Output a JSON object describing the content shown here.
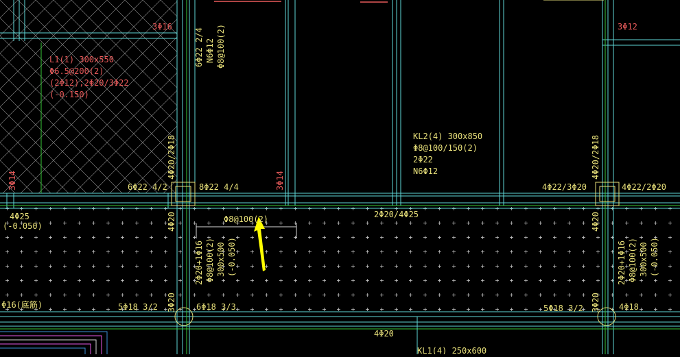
{
  "colors": {
    "background": "#000000",
    "beam_line": "#5fd7d7",
    "axis_line": "#37c837",
    "annotation_yellow": "#e8e07a",
    "annotation_red": "#e85a5a",
    "arrow": "#ffff00",
    "white": "#d8d8d8"
  },
  "annotations": {
    "l1_line1": "L1(1) 300x550",
    "l1_line2": "Φ6.5@200(2)",
    "l1_line3": "(2Φ12);2Φ20/3Φ22",
    "l1_line4": "(-0.150)",
    "kl2_line1": "KL2(4) 300x850",
    "kl2_line2": "Φ8@100/150(2)",
    "kl2_line3": "2Φ22",
    "kl2_line4": "N6Φ12",
    "top_left_3phi16": "3Φ16",
    "top_right_3phi12": "3Φ12",
    "col_left_v1": "6Φ22 2/4",
    "col_left_v2": "N6Φ12",
    "col_left_v3": "Φ8@100(2)",
    "left_red_3phi14": "3Φ14",
    "mid_red_3phi14": "3Φ14",
    "left_4phi20_2phi18": "4Φ20/2Φ18",
    "right_4phi20_2phi18": "4Φ20/2Φ18",
    "beam_6phi22": "6Φ22 4/2",
    "beam_8phi22": "8Φ22 4/4",
    "beam_4phi22_3phi20": "4Φ22/3Φ20",
    "beam_4phi22_2phi20": "4Φ22/2Φ20",
    "left_4phi25": "4Φ25",
    "left_elev": "(-0.050)",
    "stirrup_callout": "Φ8@100(2)",
    "mid_2phi20_4phi25": "2Φ20/4Φ25",
    "left_4phi20_a": "4Φ20",
    "right_4phi20_a": "4Φ20",
    "left_vbeam_1": "2Φ20+1Φ16",
    "left_vbeam_2": "Φ8@100(2)",
    "left_vbeam_3": "300x500",
    "left_vbeam_4": "(-0.050)",
    "right_vbeam_1": "2Φ20+1Φ16",
    "right_vbeam_2": "Φ8@100(2)",
    "right_vbeam_3": "300x500",
    "right_vbeam_4": "(-0.050)",
    "left_phi16": "Φ16(底筋)",
    "bottom_5phi18_left": "5Φ18 3/2",
    "bottom_3phi20_left": "3Φ20",
    "bottom_6phi18": "6Φ18 3/3",
    "bottom_5phi18_right": "5Φ18 3/2",
    "bottom_3phi20_right": "3Φ20",
    "bottom_4phi18": "4Φ18",
    "bottom_4phi20": "4Φ20",
    "bottom_kl1": "KL1(4) 250x600"
  }
}
